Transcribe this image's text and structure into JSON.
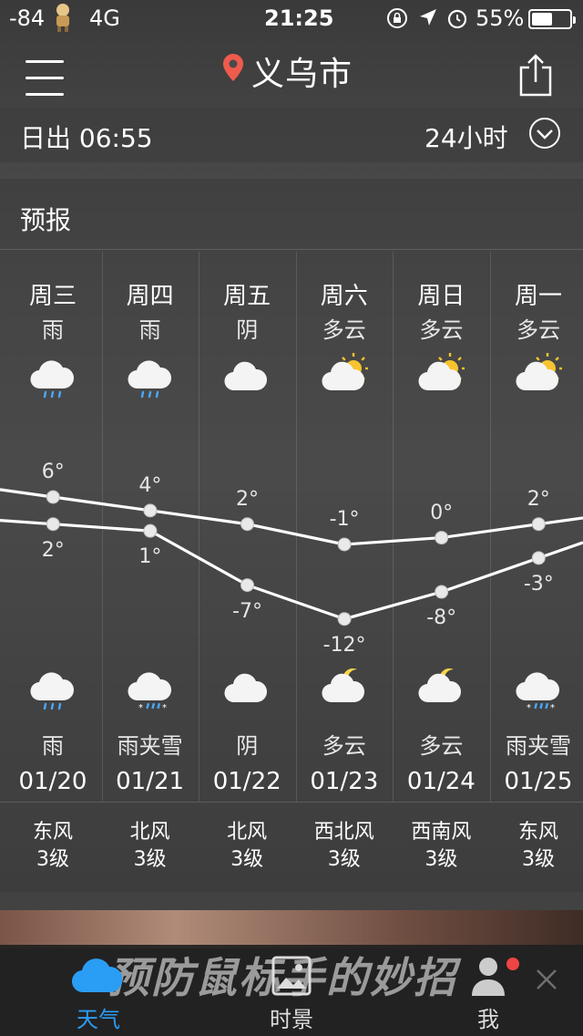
{
  "status_bar": {
    "signal": "-84",
    "network": "4G",
    "time": "21:25",
    "battery": "55%",
    "battery_level": 0.55
  },
  "header": {
    "city": "义乌市",
    "pin_color": "#ef5b4c",
    "menu_icon": "menu-icon",
    "share_icon": "share-icon"
  },
  "info_bar": {
    "sunrise": "日出 06:55",
    "hours_toggle": "24小时"
  },
  "forecast": {
    "title": "预报",
    "days": [
      {
        "weekday": "周三",
        "day_condition": "雨",
        "day_icon": "rain-icon",
        "high": "6°",
        "low": "2°",
        "night_icon": "rain-icon",
        "night_condition": "雨",
        "date": "01/20",
        "wind_dir": "东风",
        "wind_level": "3级"
      },
      {
        "weekday": "周四",
        "day_condition": "雨",
        "day_icon": "rain-icon",
        "high": "4°",
        "low": "1°",
        "night_icon": "sleet-icon",
        "night_condition": "雨夹雪",
        "date": "01/21",
        "wind_dir": "北风",
        "wind_level": "3级"
      },
      {
        "weekday": "周五",
        "day_condition": "阴",
        "day_icon": "cloud-icon",
        "high": "2°",
        "low": "-7°",
        "night_icon": "cloud-icon",
        "night_condition": "阴",
        "date": "01/22",
        "wind_dir": "北风",
        "wind_level": "3级"
      },
      {
        "weekday": "周六",
        "day_condition": "多云",
        "day_icon": "partly-sunny-icon",
        "high": "-1°",
        "low": "-12°",
        "night_icon": "partly-moon-icon",
        "night_condition": "多云",
        "date": "01/23",
        "wind_dir": "西北风",
        "wind_level": "3级"
      },
      {
        "weekday": "周日",
        "day_condition": "多云",
        "day_icon": "partly-sunny-icon",
        "high": "0°",
        "low": "-8°",
        "night_icon": "partly-moon-icon",
        "night_condition": "多云",
        "date": "01/24",
        "wind_dir": "西南风",
        "wind_level": "3级"
      },
      {
        "weekday": "周一",
        "day_condition": "多云",
        "day_icon": "partly-sunny-icon",
        "high": "2°",
        "low": "-3°",
        "night_icon": "sleet-icon",
        "night_condition": "雨夹雪",
        "date": "01/25",
        "wind_dir": "东风",
        "wind_level": "3级"
      }
    ]
  },
  "chart_data": {
    "type": "line",
    "categories": [
      "01/20",
      "01/21",
      "01/22",
      "01/23",
      "01/24",
      "01/25"
    ],
    "series": [
      {
        "values": [
          6,
          4,
          2,
          -1,
          0,
          2
        ]
      },
      {
        "values": [
          2,
          1,
          -7,
          -12,
          -8,
          -3
        ]
      }
    ]
  },
  "ad_banner": {
    "text": "预防鼠标手的妙招"
  },
  "tabbar": {
    "tabs": [
      {
        "label": "天气",
        "icon": "cloud-icon",
        "active": true
      },
      {
        "label": "时景",
        "icon": "image-icon",
        "active": false
      },
      {
        "label": "我",
        "icon": "person-icon",
        "active": false
      }
    ],
    "active_color": "#2a9df4",
    "notification_color": "#ef4444"
  }
}
